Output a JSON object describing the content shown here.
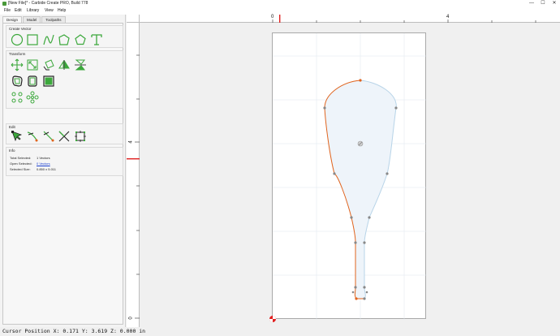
{
  "window": {
    "title": "[New File]* - Carbide Create PRO, Build 778",
    "minimize": "—",
    "maximize": "☐",
    "close": "✕"
  },
  "menu": {
    "items": [
      "File",
      "Edit",
      "Library",
      "View",
      "Help"
    ]
  },
  "panel": {
    "tabs": [
      "Design",
      "Model",
      "Toolpaths"
    ],
    "active_tab": "Design",
    "create_vector": {
      "title": "Create Vector",
      "tools": [
        "circle-tool-icon",
        "rectangle-tool-icon",
        "curve-tool-icon",
        "polyline-tool-icon",
        "polygon-tool-icon",
        "text-tool-icon"
      ]
    },
    "transform": {
      "title": "Transform",
      "tools": [
        "move-tool-icon",
        "scale-tool-icon",
        "rotate-tool-icon",
        "mirror-tool-icon",
        "align-tool-icon",
        "offset-tool-icon",
        "join-tool-icon",
        "boolean-tool-icon",
        "array-tool-icon",
        "radial-array-tool-icon"
      ]
    },
    "edit": {
      "title": "Edit",
      "tools": [
        "node-edit-icon",
        "trim-tool-icon",
        "fillet-tool-icon",
        "cut-tool-icon",
        "bounding-box-icon"
      ]
    },
    "info": {
      "title": "Info",
      "total_selected_label": "Total Selected:",
      "total_selected_value": "1 Vectors",
      "open_selected_label": "Open Selected:",
      "open_selected_value": "0 Vectors",
      "selected_size_label": "Selected Size:",
      "selected_size_value": "0.850 x 5.011"
    }
  },
  "rulers": {
    "top_labels": [
      "0",
      "4"
    ],
    "left_labels": [
      "4",
      "0"
    ],
    "marker_color": "#e02020"
  },
  "colors": {
    "accent_green": "#3ca83c",
    "selected_path": "#e0641e",
    "unselected_path": "#b8d4e8",
    "fill": "#eef4fa"
  },
  "status": {
    "cursor_text": "Cursor Position X: 0.171 Y: 3.619 Z: 0.000 in"
  }
}
